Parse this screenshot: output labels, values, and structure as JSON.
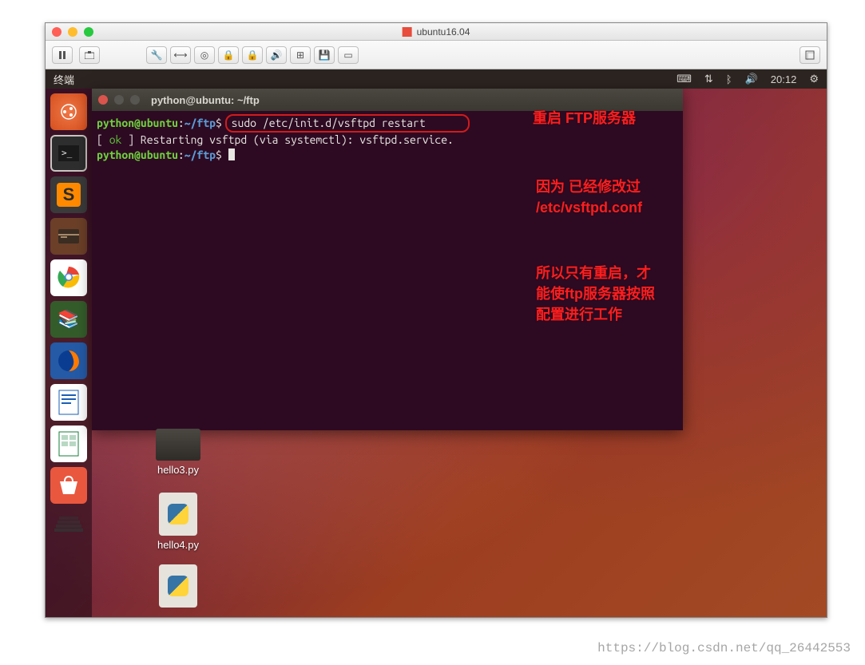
{
  "mac": {
    "title": "ubuntu16.04",
    "toolbar": {
      "pause": "pause-icon",
      "snapshot": "snapshot-icon",
      "icons": [
        "wrench",
        "link",
        "disk",
        "lock",
        "lock",
        "sound",
        "usb",
        "floppy",
        "display"
      ],
      "right": "fullscreen-icon"
    }
  },
  "ubuntu": {
    "panel": {
      "app_label": "终端",
      "time": "20:12",
      "status_icons": [
        "keyboard",
        "network",
        "bluetooth",
        "volume",
        "gear"
      ]
    },
    "launcher": {
      "items": [
        "dash",
        "terminal",
        "sublime",
        "files",
        "chrome",
        "books",
        "firefox",
        "writer",
        "calc",
        "software",
        "stack"
      ]
    }
  },
  "terminal": {
    "title": "python@ubuntu: ~/ftp",
    "lines": [
      {
        "type": "prompt",
        "user": "python@ubuntu",
        "sep": ":",
        "path": "~/ftp",
        "sigil": "$",
        "cmd": "sudo /etc/init.d/vsftpd restart",
        "highlight": true
      },
      {
        "type": "output",
        "text": "[ ok ] Restarting vsftpd (via systemctl): vsftpd.service."
      },
      {
        "type": "prompt",
        "user": "python@ubuntu",
        "sep": ":",
        "path": "~/ftp",
        "sigil": "$",
        "cmd": "",
        "cursor": true
      }
    ]
  },
  "annotations": {
    "a1": "重启 FTP服务器",
    "a2": "因为 已经修改过 /etc/vsftpd.conf",
    "a3": "所以只有重启，才能使ftp服务器按照配置进行工作"
  },
  "desktop": {
    "icons": [
      {
        "label": "hello3.py",
        "kind": "folder"
      },
      {
        "label": "hello4.py",
        "kind": "py"
      },
      {
        "label": "",
        "kind": "py"
      }
    ]
  },
  "watermark": "https://blog.csdn.net/qq_26442553"
}
